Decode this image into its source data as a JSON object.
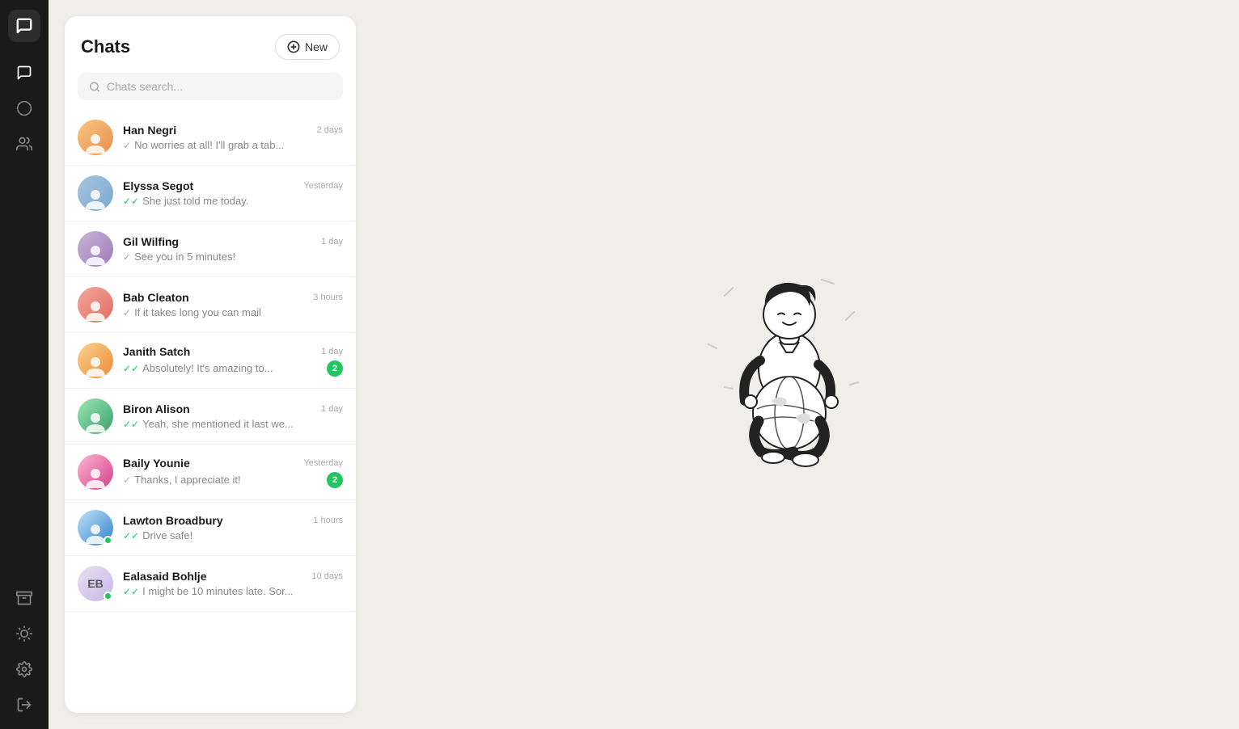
{
  "sidebar": {
    "logo_icon": "chat-bubble",
    "items": [
      {
        "id": "chats",
        "icon": "comment",
        "active": true
      },
      {
        "id": "status",
        "icon": "circle-dashed",
        "active": false
      },
      {
        "id": "contacts",
        "icon": "users",
        "active": false
      }
    ],
    "bottom_items": [
      {
        "id": "archive",
        "icon": "archive"
      },
      {
        "id": "theme",
        "icon": "sun"
      },
      {
        "id": "settings",
        "icon": "gear"
      },
      {
        "id": "logout",
        "icon": "logout"
      }
    ]
  },
  "chats": {
    "title": "Chats",
    "new_button_label": "New",
    "search_placeholder": "Chats search...",
    "items": [
      {
        "id": 1,
        "name": "Han Negri",
        "time": "2 days",
        "preview": "No worries at all! I'll grab a tab...",
        "double_check": false,
        "single_check": true,
        "check_green": false,
        "unread": 0,
        "online": false,
        "avatar_type": "image",
        "avatar_color": "av1"
      },
      {
        "id": 2,
        "name": "Elyssa Segot",
        "time": "Yesterday",
        "preview": "She just told me today.",
        "double_check": true,
        "check_green": true,
        "unread": 0,
        "online": false,
        "avatar_type": "image",
        "avatar_color": "av2"
      },
      {
        "id": 3,
        "name": "Gil Wilfing",
        "time": "1 day",
        "preview": "See you in 5 minutes!",
        "double_check": false,
        "single_check": true,
        "check_green": false,
        "unread": 0,
        "online": false,
        "avatar_type": "image",
        "avatar_color": "av3"
      },
      {
        "id": 4,
        "name": "Bab Cleaton",
        "time": "3 hours",
        "preview": "If it takes long you can mail",
        "double_check": false,
        "single_check": true,
        "check_green": false,
        "unread": 0,
        "online": false,
        "avatar_type": "image",
        "avatar_color": "av4"
      },
      {
        "id": 5,
        "name": "Janith Satch",
        "time": "1 day",
        "preview": "Absolutely! It's amazing to...",
        "double_check": true,
        "check_green": true,
        "unread": 2,
        "online": false,
        "avatar_type": "image",
        "avatar_color": "av5"
      },
      {
        "id": 6,
        "name": "Biron Alison",
        "time": "1 day",
        "preview": "Yeah, she mentioned it last we...",
        "double_check": true,
        "check_green": true,
        "unread": 0,
        "online": false,
        "avatar_type": "image",
        "avatar_color": "av6"
      },
      {
        "id": 7,
        "name": "Baily Younie",
        "time": "Yesterday",
        "preview": "Thanks, I appreciate it!",
        "double_check": false,
        "single_check": true,
        "check_green": false,
        "unread": 2,
        "online": false,
        "avatar_type": "image",
        "avatar_color": "av7"
      },
      {
        "id": 8,
        "name": "Lawton Broadbury",
        "time": "1 hours",
        "preview": "Drive safe!",
        "double_check": true,
        "check_green": true,
        "unread": 0,
        "online": true,
        "avatar_type": "image",
        "avatar_color": "av8"
      },
      {
        "id": 9,
        "name": "Ealasaid Bohlje",
        "time": "10 days",
        "preview": "I might be 10 minutes late. Sor...",
        "double_check": true,
        "check_green": true,
        "unread": 0,
        "online": true,
        "avatar_type": "initials",
        "initials": "EB",
        "avatar_color": "av_eb"
      }
    ]
  }
}
